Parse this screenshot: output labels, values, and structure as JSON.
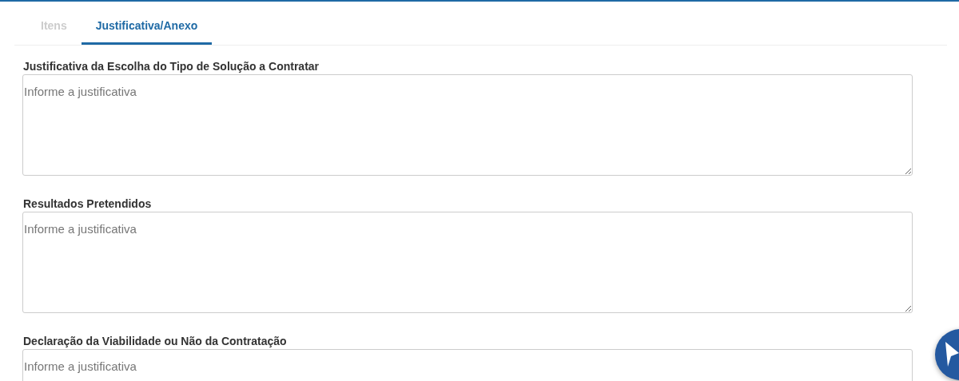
{
  "tabs": [
    {
      "label": "Itens",
      "selected": false
    },
    {
      "label": "Justificativa/Anexo",
      "selected": true
    }
  ],
  "fields": [
    {
      "label": "Justificativa da Escolha do Tipo de Solução a Contratar",
      "placeholder": "Informe a justificativa"
    },
    {
      "label": "Resultados Pretendidos",
      "placeholder": "Informe a justificativa"
    },
    {
      "label": "Declaração da Viabilidade ou Não da Contratação",
      "placeholder": "Informe a justificativa"
    }
  ]
}
